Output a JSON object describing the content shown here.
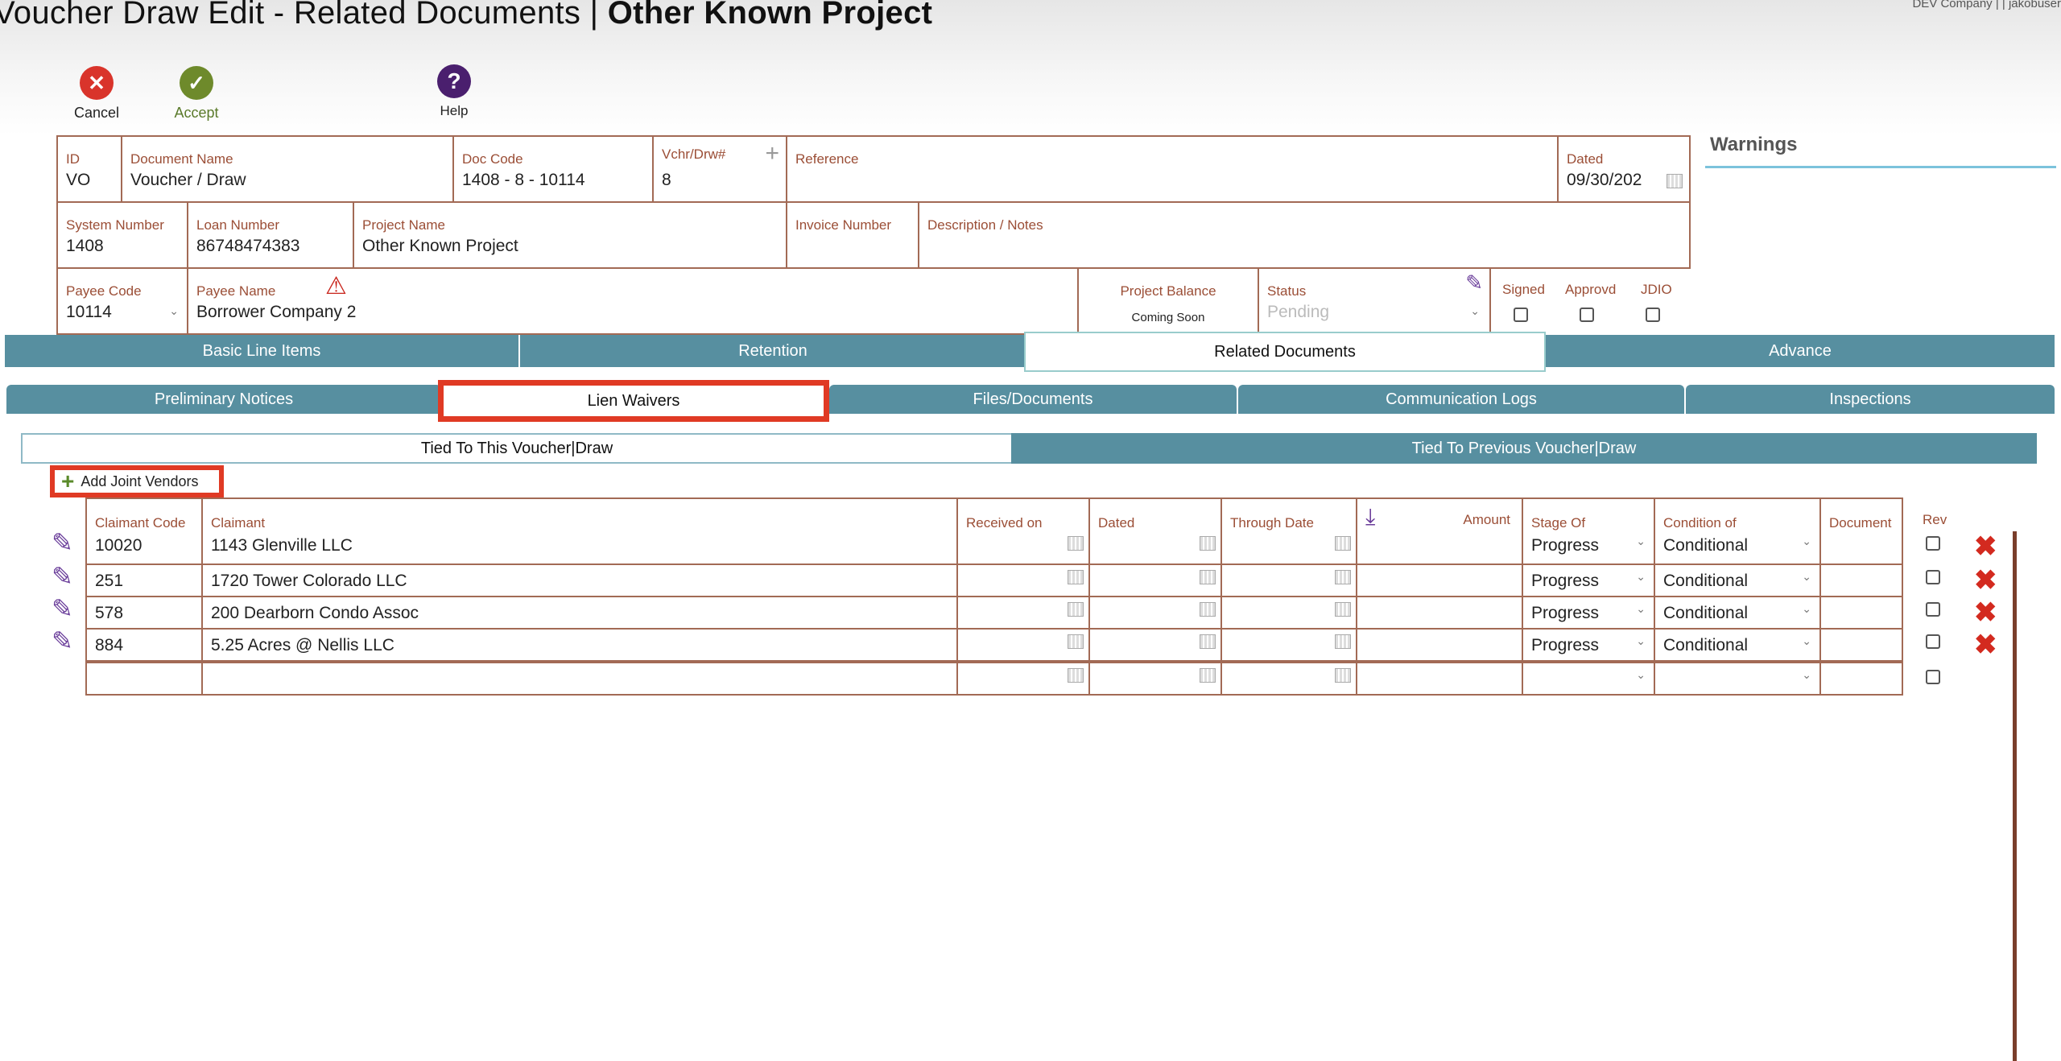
{
  "header": {
    "title_prefix": "Voucher Draw Edit - Related Documents | ",
    "title_project": "Other Known Project",
    "user_info": "DEV Company | | jakobuser"
  },
  "toolbar": {
    "cancel_label": "Cancel",
    "accept_label": "Accept",
    "help_label": "Help"
  },
  "form": {
    "id": {
      "label": "ID",
      "value": "VO"
    },
    "document_name": {
      "label": "Document Name",
      "value": "Voucher / Draw"
    },
    "doc_code": {
      "label": "Doc Code",
      "value": "1408 - 8 - 10114"
    },
    "vchr_drw": {
      "label": "Vchr/Drw#",
      "value": "8"
    },
    "reference": {
      "label": "Reference",
      "value": ""
    },
    "dated": {
      "label": "Dated",
      "value": "09/30/202"
    },
    "system_number": {
      "label": "System Number",
      "value": "1408"
    },
    "loan_number": {
      "label": "Loan Number",
      "value": "86748474383"
    },
    "project_name": {
      "label": "Project Name",
      "value": "Other Known Project"
    },
    "invoice_number": {
      "label": "Invoice Number",
      "value": ""
    },
    "description": {
      "label": "Description / Notes",
      "value": ""
    },
    "payee_code": {
      "label": "Payee Code",
      "value": "10114"
    },
    "payee_name": {
      "label": "Payee Name",
      "value": "Borrower Company 2"
    },
    "project_balance": {
      "label": "Project Balance",
      "value": "Coming Soon"
    },
    "status": {
      "label": "Status",
      "value": "Pending"
    },
    "signed_label": "Signed",
    "approvd_label": "Approvd",
    "jdio_label": "JDIO"
  },
  "warnings": {
    "title": "Warnings"
  },
  "main_tabs": [
    "Basic Line Items",
    "Retention",
    "Related Documents",
    "Advance"
  ],
  "sub_tabs": [
    "Preliminary Notices",
    "Lien Waivers",
    "Files/Documents",
    "Communication Logs",
    "Inspections"
  ],
  "tie_tabs": [
    "Tied To This Voucher|Draw",
    "Tied To Previous Voucher|Draw"
  ],
  "add_joint_vendors_label": "Add Joint Vendors",
  "grid": {
    "headers": {
      "claimant_code": "Claimant Code",
      "claimant": "Claimant",
      "received_on": "Received on",
      "dated": "Dated",
      "through_date": "Through Date",
      "amount": "Amount",
      "stage_of": "Stage Of",
      "condition_of": "Condition of",
      "document": "Document",
      "rev": "Rev"
    },
    "rows": [
      {
        "code": "10020",
        "claimant": "1143 Glenville LLC",
        "stage": "Progress",
        "condition": "Conditional"
      },
      {
        "code": "251",
        "claimant": "1720 Tower Colorado LLC",
        "stage": "Progress",
        "condition": "Conditional"
      },
      {
        "code": "578",
        "claimant": "200 Dearborn Condo Assoc",
        "stage": "Progress",
        "condition": "Conditional"
      },
      {
        "code": "884",
        "claimant": "5.25 Acres @ Nellis LLC",
        "stage": "Progress",
        "condition": "Conditional"
      }
    ]
  },
  "colors": {
    "tab_teal": "#578fa0",
    "label_brown": "#9b4e36",
    "highlight_red": "#e03a24"
  }
}
